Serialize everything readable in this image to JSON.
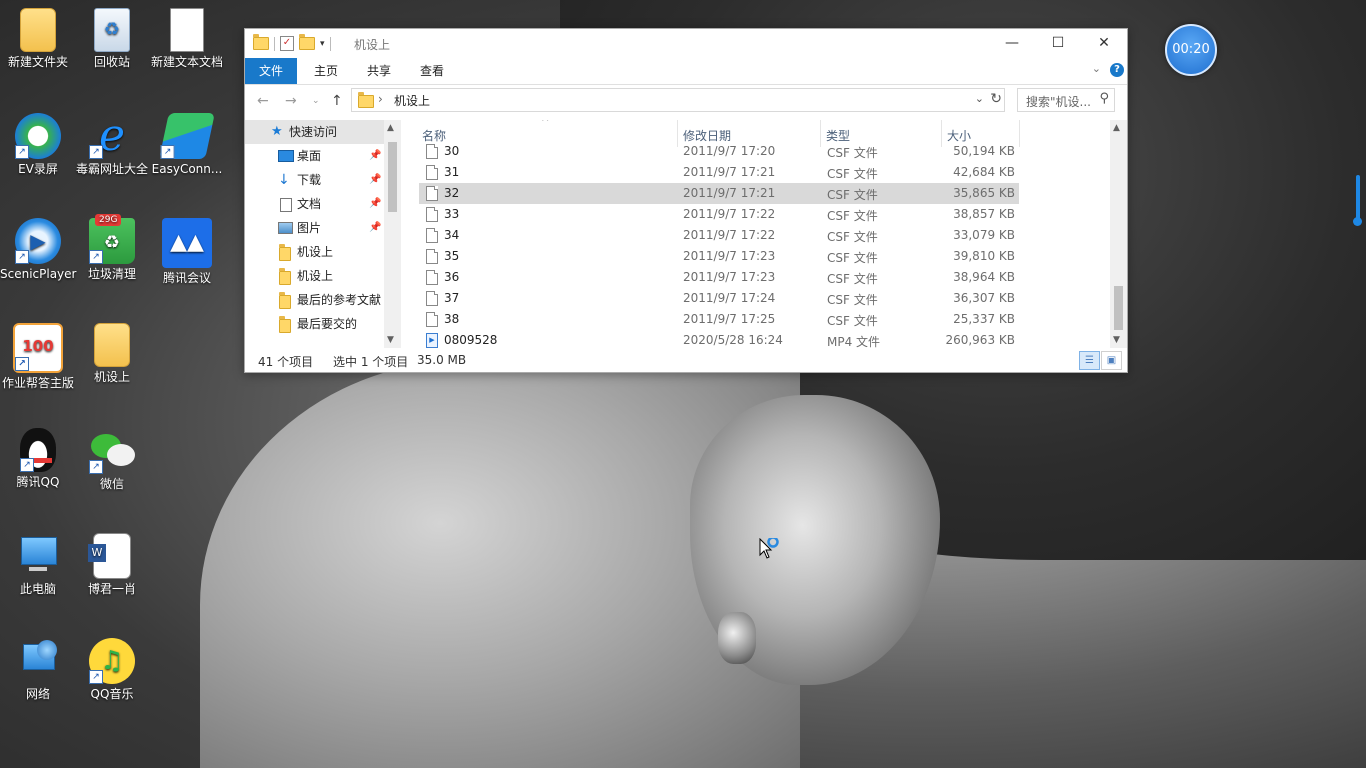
{
  "desktop": {
    "icons": [
      {
        "label": "新建文件夹",
        "icon": "folder-icon"
      },
      {
        "label": "回收站",
        "icon": "recycle-bin-icon"
      },
      {
        "label": "新建文本文档",
        "icon": "text-document-icon"
      },
      {
        "label": "EV录屏",
        "icon": "ev-recorder-icon"
      },
      {
        "label": "毒霸网址大全",
        "icon": "ie-browser-icon"
      },
      {
        "label": "EasyConn...",
        "icon": "easyconnect-icon"
      },
      {
        "label": "ScenicPlayer",
        "icon": "player-icon"
      },
      {
        "label": "垃圾清理",
        "icon": "trash-cleaner-icon"
      },
      {
        "label": "腾讯会议",
        "icon": "tencent-meeting-icon"
      },
      {
        "label": "作业帮答主版",
        "icon": "zuoyebang-icon"
      },
      {
        "label": "机设上",
        "icon": "folder-icon"
      },
      {
        "label": "腾讯QQ",
        "icon": "qq-icon"
      },
      {
        "label": "微信",
        "icon": "wechat-icon"
      },
      {
        "label": "此电脑",
        "icon": "computer-icon"
      },
      {
        "label": "博君一肖",
        "icon": "word-document-icon"
      },
      {
        "label": "网络",
        "icon": "network-icon"
      },
      {
        "label": "QQ音乐",
        "icon": "qq-music-icon"
      }
    ],
    "cleaner_badge": "29G",
    "timer": "00:20"
  },
  "explorer": {
    "title": "机设上",
    "window_buttons": {
      "minimize": "—",
      "maximize": "☐",
      "close": "✕"
    },
    "ribbon_tabs": [
      "文件",
      "主页",
      "共享",
      "查看"
    ],
    "active_tab": "文件",
    "help_label": "?",
    "address": {
      "crumb": "机设上"
    },
    "search_placeholder": "搜索\"机设...",
    "nav_pane": {
      "quick_access": "快速访问",
      "items": [
        {
          "label": "桌面",
          "icon": "desktop-icon",
          "pinned": true
        },
        {
          "label": "下载",
          "icon": "download-icon",
          "pinned": true
        },
        {
          "label": "文档",
          "icon": "documents-icon",
          "pinned": true
        },
        {
          "label": "图片",
          "icon": "pictures-icon",
          "pinned": true
        },
        {
          "label": "机设上",
          "icon": "folder-icon",
          "pinned": false
        },
        {
          "label": "机设上",
          "icon": "folder-icon",
          "pinned": false
        },
        {
          "label": "最后的参考文献",
          "icon": "folder-icon",
          "pinned": false
        },
        {
          "label": "最后要交的",
          "icon": "folder-icon",
          "pinned": false
        }
      ]
    },
    "columns": {
      "name": "名称",
      "modified": "修改日期",
      "type": "类型",
      "size": "大小"
    },
    "files": [
      {
        "name": "30",
        "modified": "2011/9/7 17:20",
        "type": "CSF 文件",
        "size": "50,194 KB",
        "kind": "doc",
        "selected": false
      },
      {
        "name": "31",
        "modified": "2011/9/7 17:21",
        "type": "CSF 文件",
        "size": "42,684 KB",
        "kind": "doc",
        "selected": false
      },
      {
        "name": "32",
        "modified": "2011/9/7 17:21",
        "type": "CSF 文件",
        "size": "35,865 KB",
        "kind": "doc",
        "selected": true
      },
      {
        "name": "33",
        "modified": "2011/9/7 17:22",
        "type": "CSF 文件",
        "size": "38,857 KB",
        "kind": "doc",
        "selected": false
      },
      {
        "name": "34",
        "modified": "2011/9/7 17:22",
        "type": "CSF 文件",
        "size": "33,079 KB",
        "kind": "doc",
        "selected": false
      },
      {
        "name": "35",
        "modified": "2011/9/7 17:23",
        "type": "CSF 文件",
        "size": "39,810 KB",
        "kind": "doc",
        "selected": false
      },
      {
        "name": "36",
        "modified": "2011/9/7 17:23",
        "type": "CSF 文件",
        "size": "38,964 KB",
        "kind": "doc",
        "selected": false
      },
      {
        "name": "37",
        "modified": "2011/9/7 17:24",
        "type": "CSF 文件",
        "size": "36,307 KB",
        "kind": "doc",
        "selected": false
      },
      {
        "name": "38",
        "modified": "2011/9/7 17:25",
        "type": "CSF 文件",
        "size": "25,337 KB",
        "kind": "doc",
        "selected": false
      },
      {
        "name": "0809528",
        "modified": "2020/5/28 16:24",
        "type": "MP4 文件",
        "size": "260,963 KB",
        "kind": "mp4",
        "selected": false
      }
    ],
    "status": {
      "count": "41 个项目",
      "selection": "选中 1 个项目",
      "size": "35.0 MB"
    }
  }
}
